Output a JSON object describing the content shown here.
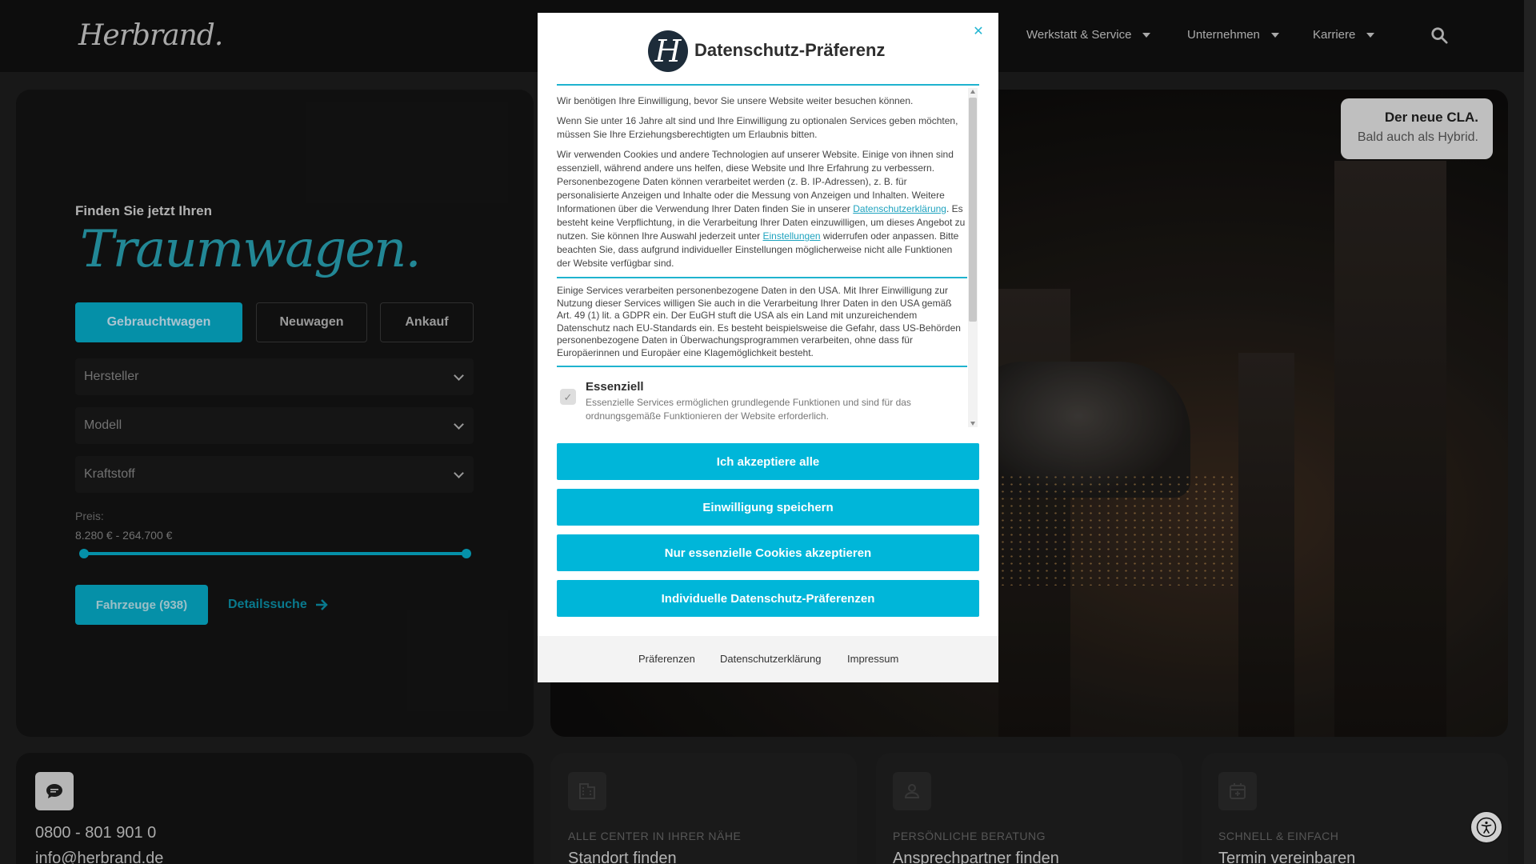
{
  "header": {
    "logo": "Herbrand.",
    "nav": [
      {
        "label": "Werkstatt & Service"
      },
      {
        "label": "Unternehmen"
      },
      {
        "label": "Karriere"
      }
    ]
  },
  "search_form": {
    "eyebrow": "Finden Sie jetzt Ihren",
    "script_word": "Traumwagen.",
    "tabs": [
      "Gebrauchtwagen",
      "Neuwagen",
      "Ankauf"
    ],
    "active_tab": "Gebrauchtwagen",
    "selects": {
      "manufacturer": "Hersteller",
      "model": "Modell",
      "fuel": "Kraftstoff"
    },
    "price_label": "Preis:",
    "price_range": "8.280 € - 264.700 €",
    "price_min": 8280,
    "price_max": 264700,
    "vehicles_button": "Fahrzeuge (938)",
    "detail_link": "Detailssuche"
  },
  "hero": {
    "promo_title": "Der neue CLA.",
    "promo_subtitle": "Bald auch als Hybrid."
  },
  "contact_card": {
    "phone": "0800 - 801 901 0",
    "email": "info@herbrand.de"
  },
  "feature_cards": [
    {
      "eyebrow": "ALLE CENTER IN IHRER NÄHE",
      "title": "Standort finden",
      "icon": "building-icon"
    },
    {
      "eyebrow": "PERSÖNLICHE BERATUNG",
      "title": "Ansprechpartner finden",
      "icon": "person-icon"
    },
    {
      "eyebrow": "SCHNELL & EINFACH",
      "title": "Termin vereinbaren",
      "icon": "calendar-add-icon"
    }
  ],
  "consent": {
    "title": "Datenschutz-Präferenz",
    "p1": "Wir benötigen Ihre Einwilligung, bevor Sie unsere Website weiter besuchen können.",
    "p2": "Wenn Sie unter 16 Jahre alt sind und Ihre Einwilligung zu optionalen Services geben möchten, müssen Sie Ihre Erziehungsberechtigten um Erlaubnis bitten.",
    "p3_a": "Wir verwenden Cookies und andere Technologien auf unserer Website. Einige von ihnen sind essenziell, während andere uns helfen, diese Website und Ihre Erfahrung zu verbessern. Personenbezogene Daten können verarbeitet werden (z. B. IP-Adressen), z. B. für personalisierte Anzeigen und Inhalte oder die Messung von Anzeigen und Inhalten. Weitere Informationen über die Verwendung Ihrer Daten finden Sie in unserer ",
    "p3_link1": "Datenschutzerklärung",
    "p3_b": ". Es besteht keine Verpflichtung, in die Verarbeitung Ihrer Daten einzuwilligen, um dieses Angebot zu nutzen. Sie können Ihre Auswahl jederzeit unter ",
    "p3_link2": "Einstellungen",
    "p3_c": " widerrufen oder anpassen. Bitte beachten Sie, dass aufgrund individueller Einstellungen möglicherweise nicht alle Funktionen der Website verfügbar sind.",
    "p4": "Einige Services verarbeiten personenbezogene Daten in den USA. Mit Ihrer Einwilligung zur Nutzung dieser Services willigen Sie auch in die Verarbeitung Ihrer Daten in den USA gemäß Art. 49 (1) lit. a GDPR ein. Der EuGH stuft die USA als ein Land mit unzureichendem Datenschutz nach EU-Standards ein. Es besteht beispielsweise die Gefahr, dass US-Behörden personenbezogene Daten in Überwachungsprogrammen verarbeiten, ohne dass für Europäerinnen und Europäer eine Klagemöglichkeit besteht.",
    "essential_title": "Essenziell",
    "essential_desc": "Essenzielle Services ermöglichen grundlegende Funktionen und sind für das ordnungsgemäße Funktionieren der Website erforderlich.",
    "buttons": {
      "accept_all": "Ich akzeptiere alle",
      "save": "Einwilligung speichern",
      "essential_only": "Nur essenzielle Cookies akzeptieren",
      "individual": "Individuelle Datenschutz-Präferenzen"
    },
    "footer": {
      "preferences": "Präferenzen",
      "privacy": "Datenschutzerklärung",
      "imprint": "Impressum"
    },
    "accent_color": "#00b6d9"
  }
}
